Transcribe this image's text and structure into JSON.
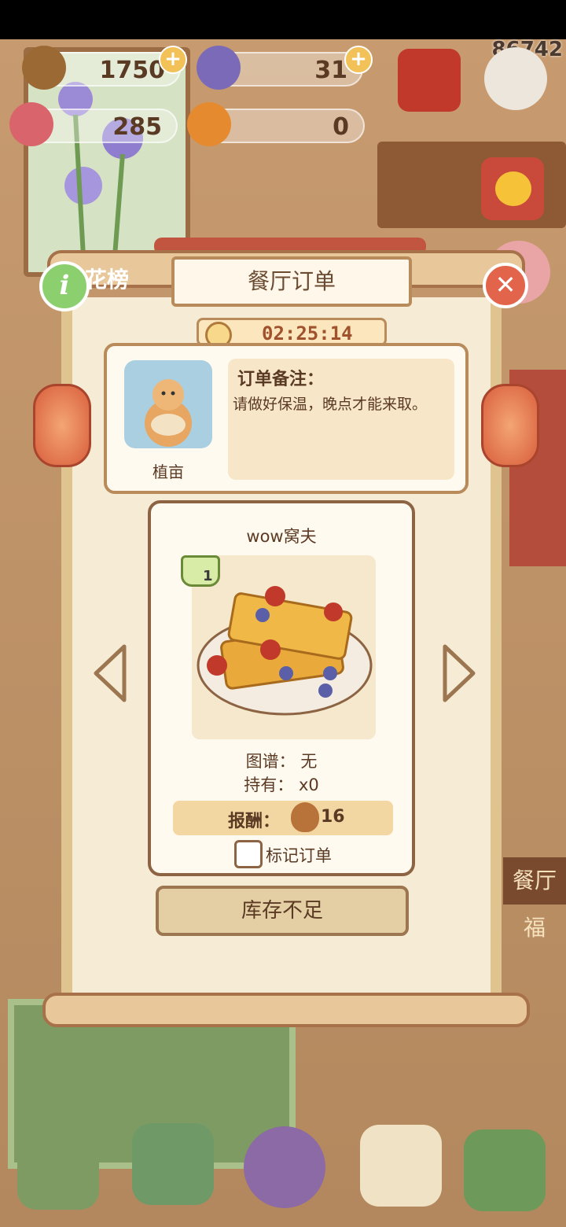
{
  "top_right_number": "86742",
  "currencies": [
    {
      "name": "acorn",
      "value": "1750",
      "has_plus": true
    },
    {
      "name": "gem",
      "value": "31",
      "has_plus": true
    },
    {
      "name": "heart",
      "value": "285",
      "has_plus": false
    },
    {
      "name": "orange",
      "value": "0",
      "has_plus": false
    }
  ],
  "background_label": "花榜",
  "background_sign": "餐厅福",
  "dialog": {
    "title": "餐厅订单",
    "timer": "02:25:14",
    "customer_name": "植亩",
    "note_title": "订单备注：",
    "note_text": "请做好保温，晚点才能来取。",
    "dish_name": "wow窝夫",
    "pot_count": "1",
    "recipe_line": "图谱： 无",
    "owned_line": "持有： x0",
    "reward_label": "报酬：",
    "reward_value": "16",
    "mark_label": "标记订单",
    "action_button": "库存不足"
  },
  "colors": {
    "accent_red": "#e2644a",
    "info_green": "#8ccf6e",
    "panel_cream": "#fffaf0"
  }
}
